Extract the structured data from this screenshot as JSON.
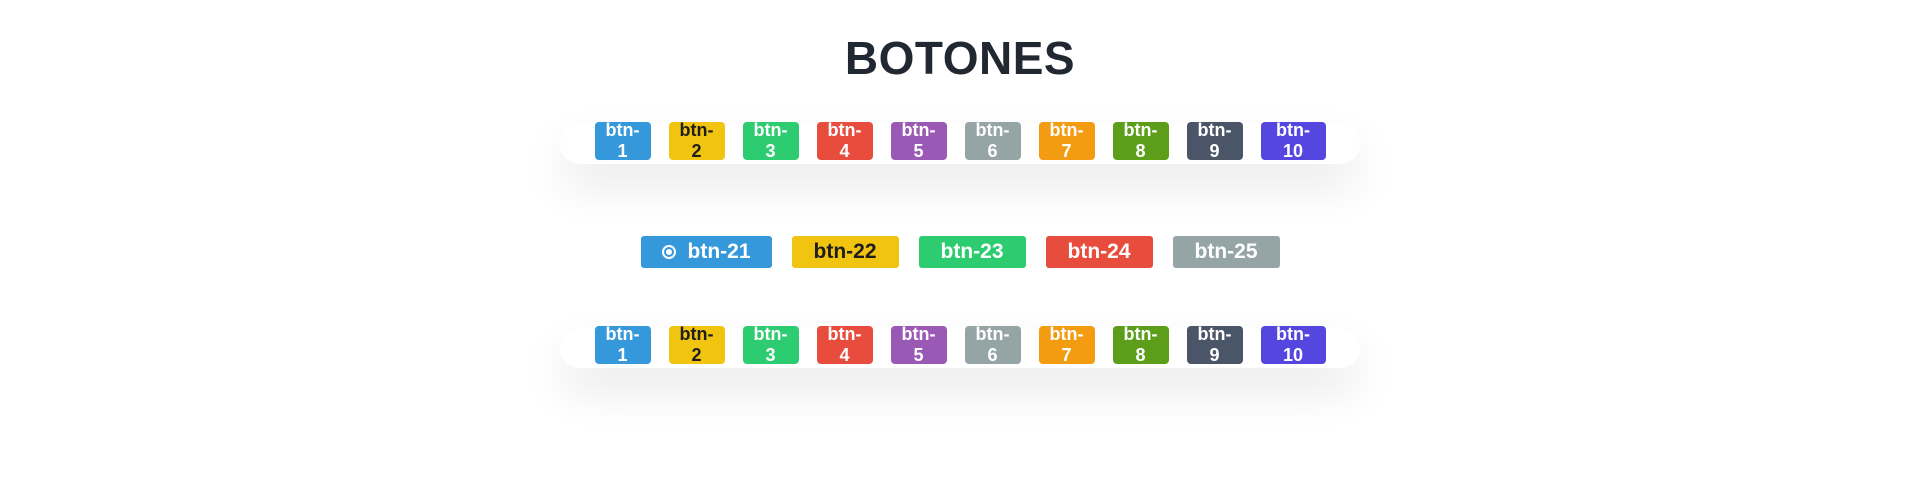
{
  "page": {
    "title": "BOTONES"
  },
  "row_top": {
    "buttons": [
      {
        "label": "btn-1",
        "color": "#3498db"
      },
      {
        "label": "btn-2",
        "color": "#f1c40f"
      },
      {
        "label": "btn-3",
        "color": "#2ecc71"
      },
      {
        "label": "btn-4",
        "color": "#e74c3c"
      },
      {
        "label": "btn-5",
        "color": "#9b59b6"
      },
      {
        "label": "btn-6",
        "color": "#95a5a6"
      },
      {
        "label": "btn-7",
        "color": "#f39c12"
      },
      {
        "label": "btn-8",
        "color": "#5c9e1a"
      },
      {
        "label": "btn-9",
        "color": "#4a5568"
      },
      {
        "label": "btn-10",
        "color": "#5546e0"
      }
    ]
  },
  "row_middle": {
    "buttons": [
      {
        "label": "btn-21",
        "color": "#3498db",
        "icon": "radio-icon"
      },
      {
        "label": "btn-22",
        "color": "#f1c40f"
      },
      {
        "label": "btn-23",
        "color": "#2ecc71"
      },
      {
        "label": "btn-24",
        "color": "#e74c3c"
      },
      {
        "label": "btn-25",
        "color": "#95a5a6"
      }
    ]
  },
  "row_bottom": {
    "buttons": [
      {
        "label": "btn-1",
        "color": "#3498db"
      },
      {
        "label": "btn-2",
        "color": "#f1c40f"
      },
      {
        "label": "btn-3",
        "color": "#2ecc71"
      },
      {
        "label": "btn-4",
        "color": "#e74c3c"
      },
      {
        "label": "btn-5",
        "color": "#9b59b6"
      },
      {
        "label": "btn-6",
        "color": "#95a5a6"
      },
      {
        "label": "btn-7",
        "color": "#f39c12"
      },
      {
        "label": "btn-8",
        "color": "#5c9e1a"
      },
      {
        "label": "btn-9",
        "color": "#4a5568"
      },
      {
        "label": "btn-10",
        "color": "#5546e0"
      }
    ]
  }
}
